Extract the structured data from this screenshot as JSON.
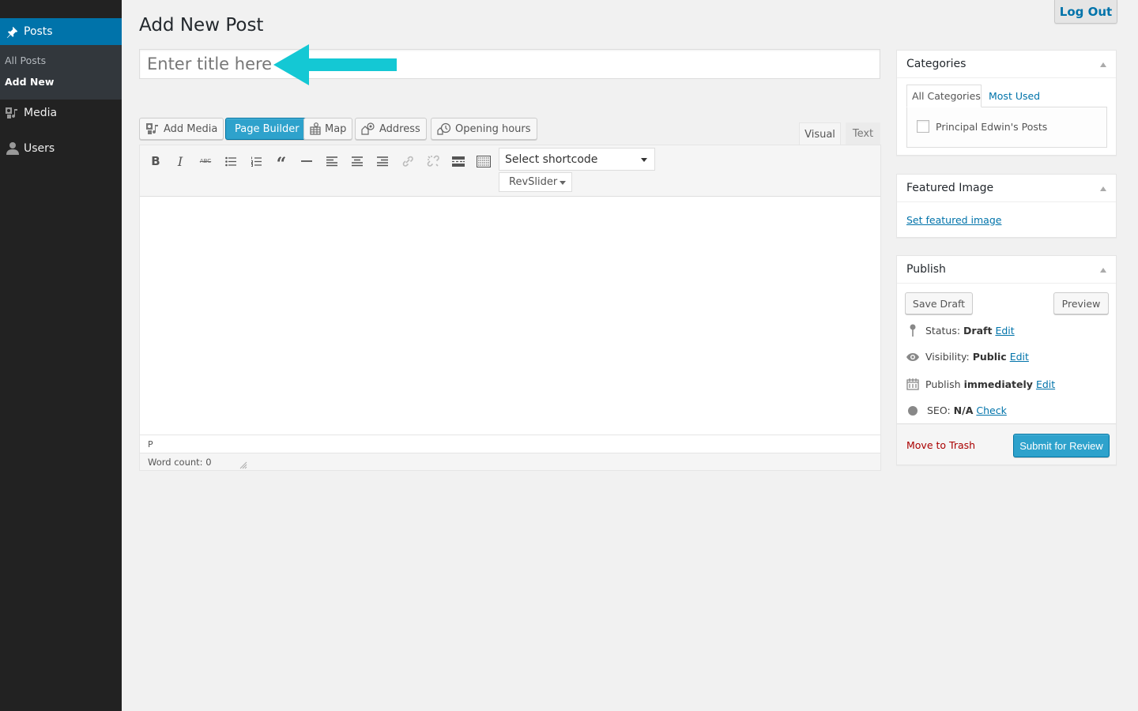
{
  "sidebar": {
    "items": [
      {
        "label": "Posts",
        "icon": "pin-icon",
        "active": true
      },
      {
        "label": "Media",
        "icon": "media-icon"
      },
      {
        "label": "Users",
        "icon": "users-icon"
      }
    ],
    "submenu": [
      {
        "label": "All Posts"
      },
      {
        "label": "Add New",
        "current": true
      }
    ]
  },
  "header": {
    "title": "Add New Post",
    "logout_label": "Log Out"
  },
  "title_field": {
    "placeholder": "Enter title here",
    "value": "",
    "annotation_arrow_color": "#14c8d4"
  },
  "media_buttons": [
    {
      "label": "Add Media",
      "icon": "add-media-icon"
    },
    {
      "label": "Page Builder",
      "primary": true
    },
    {
      "label": "Map",
      "icon": "map-icon"
    },
    {
      "label": "Address",
      "icon": "address-icon"
    },
    {
      "label": "Opening hours",
      "icon": "clock-icon"
    }
  ],
  "editor": {
    "tabs": [
      {
        "label": "Visual",
        "active": true
      },
      {
        "label": "Text"
      }
    ],
    "toolbar": [
      "bold",
      "italic",
      "strikethrough",
      "bullet-list",
      "numbered-list",
      "blockquote",
      "horizontal-line",
      "align-left",
      "align-center",
      "align-right",
      "insert-link",
      "remove-link",
      "read-more",
      "toolbar-toggle"
    ],
    "shortcode_select": "Select shortcode",
    "revslider_select": "RevSlider",
    "path": "P",
    "word_count": "Word count: 0"
  },
  "categories": {
    "title": "Categories",
    "tabs": [
      "All Categories",
      "Most Used"
    ],
    "items": [
      {
        "label": "Principal Edwin's Posts",
        "checked": false
      }
    ]
  },
  "featured_image": {
    "title": "Featured Image",
    "link": "Set featured image"
  },
  "publish": {
    "title": "Publish",
    "save_draft": "Save Draft",
    "preview": "Preview",
    "status_label": "Status:",
    "status_value": "Draft",
    "visibility_label": "Visibility:",
    "visibility_value": "Public",
    "publish_label": "Publish",
    "publish_value": "immediately",
    "seo_label": "SEO:",
    "seo_value": "N/A",
    "edit": "Edit",
    "check": "Check",
    "trash": "Move to Trash",
    "submit": "Submit for Review"
  },
  "colors": {
    "accent": "#0073aa",
    "primary_button": "#2ea2cc",
    "sidebar_bg": "#222222",
    "trash": "#aa0000"
  }
}
